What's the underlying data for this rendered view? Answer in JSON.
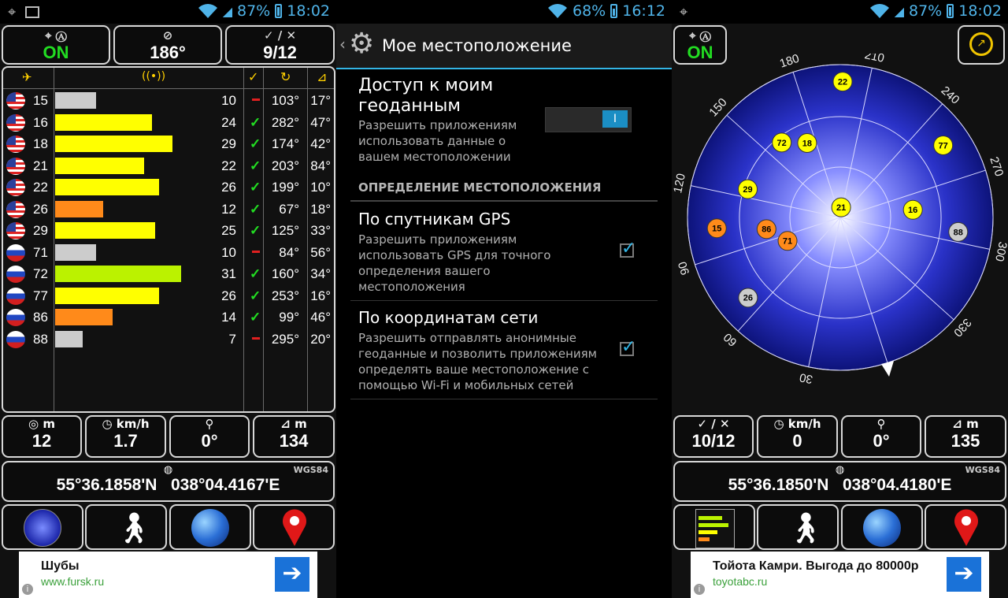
{
  "colors": {
    "accent": "#33b5e5",
    "status_blue": "#4fb3e8",
    "green": "#22dd22",
    "yellow": "#ffff00",
    "lime": "#bbf200",
    "orange": "#ff8a1a",
    "gray": "#cccccc"
  },
  "left": {
    "status": {
      "battery": "87%",
      "time": "18:02"
    },
    "tiles": {
      "gps_state": "ON",
      "heading": "186°",
      "sats": "9/12"
    },
    "satellites": [
      {
        "flag": "us",
        "id": "15",
        "snr": "10",
        "used": false,
        "az": "103°",
        "el": "17°",
        "color": "#cccccc",
        "frac": 0.22
      },
      {
        "flag": "us",
        "id": "16",
        "snr": "24",
        "used": true,
        "az": "282°",
        "el": "47°",
        "color": "#ffff00",
        "frac": 0.52
      },
      {
        "flag": "us",
        "id": "18",
        "snr": "29",
        "used": true,
        "az": "174°",
        "el": "42°",
        "color": "#ffff00",
        "frac": 0.63
      },
      {
        "flag": "us",
        "id": "21",
        "snr": "22",
        "used": true,
        "az": "203°",
        "el": "84°",
        "color": "#ffff00",
        "frac": 0.48
      },
      {
        "flag": "us",
        "id": "22",
        "snr": "26",
        "used": true,
        "az": "199°",
        "el": "10°",
        "color": "#ffff00",
        "frac": 0.56
      },
      {
        "flag": "us",
        "id": "26",
        "snr": "12",
        "used": true,
        "az": "67°",
        "el": "18°",
        "color": "#ff8a1a",
        "frac": 0.26
      },
      {
        "flag": "us",
        "id": "29",
        "snr": "25",
        "used": true,
        "az": "125°",
        "el": "33°",
        "color": "#ffff00",
        "frac": 0.54
      },
      {
        "flag": "ru",
        "id": "71",
        "snr": "10",
        "used": false,
        "az": "84°",
        "el": "56°",
        "color": "#cccccc",
        "frac": 0.22
      },
      {
        "flag": "ru",
        "id": "72",
        "snr": "31",
        "used": true,
        "az": "160°",
        "el": "34°",
        "color": "#bbf200",
        "frac": 0.68
      },
      {
        "flag": "ru",
        "id": "77",
        "snr": "26",
        "used": true,
        "az": "253°",
        "el": "16°",
        "color": "#ffff00",
        "frac": 0.56
      },
      {
        "flag": "ru",
        "id": "86",
        "snr": "14",
        "used": true,
        "az": "99°",
        "el": "46°",
        "color": "#ff8a1a",
        "frac": 0.31
      },
      {
        "flag": "ru",
        "id": "88",
        "snr": "7",
        "used": false,
        "az": "295°",
        "el": "20°",
        "color": "#cccccc",
        "frac": 0.15
      }
    ],
    "stats": {
      "acc_unit": "m",
      "acc": "12",
      "speed_unit": "km/h",
      "speed": "1.7",
      "bearing": "0°",
      "alt_unit": "m",
      "alt": "134"
    },
    "coords": {
      "datum": "WGS84",
      "lat": "55°36.1858'N",
      "lon": "038°04.4167'E"
    },
    "ad": {
      "title": "Шубы",
      "url": "www.fursk.ru"
    }
  },
  "middle": {
    "status": {
      "battery": "68%",
      "time": "16:12"
    },
    "title": "Мое местоположение",
    "access_title": "Доступ к моим геоданным",
    "access_title_line1": "Доступ к моим",
    "access_title_line2": "геоданным",
    "access_sub": "Разрешить приложениям использовать данные о вашем местоположении",
    "access_sub_lines": [
      "Разрешить приложениям",
      "использовать данные о",
      "вашем местоположении"
    ],
    "toggle_label": "I",
    "section": "ОПРЕДЕЛЕНИЕ МЕСТОПОЛОЖЕНИЯ",
    "gps_title": "По спутникам GPS",
    "gps_sub_lines": [
      "Разрешить приложениям",
      "использовать GPS для точного",
      "определения вашего",
      "местоположения"
    ],
    "net_title": "По координатам сети",
    "net_sub_lines": [
      "Разрешить отправлять анонимные",
      "геоданные и позволить приложениям",
      "определять ваше местоположение с",
      "помощью Wi-Fi и мобильных сетей"
    ]
  },
  "right": {
    "status": {
      "battery": "87%",
      "time": "18:02"
    },
    "gps_state": "ON",
    "compass_labels": [
      "30",
      "60",
      "90",
      "120",
      "150",
      "180",
      "210",
      "240",
      "270",
      "300",
      "330"
    ],
    "sky_sats": [
      {
        "id": "22",
        "color": "#ffff00"
      },
      {
        "id": "72",
        "color": "#ffff00"
      },
      {
        "id": "18",
        "color": "#ffff00"
      },
      {
        "id": "77",
        "color": "#ffff00"
      },
      {
        "id": "29",
        "color": "#ffff00"
      },
      {
        "id": "21",
        "color": "#ffff00"
      },
      {
        "id": "16",
        "color": "#ffff00"
      },
      {
        "id": "15",
        "color": "#ff8a1a"
      },
      {
        "id": "86",
        "color": "#ff8a1a"
      },
      {
        "id": "71",
        "color": "#ff8a1a"
      },
      {
        "id": "88",
        "color": "#cccccc"
      },
      {
        "id": "26",
        "color": "#cccccc"
      }
    ],
    "stats": {
      "sats": "10/12",
      "speed_unit": "km/h",
      "speed": "0",
      "bearing": "0°",
      "alt_unit": "m",
      "alt": "135"
    },
    "coords": {
      "datum": "WGS84",
      "lat": "55°36.1850'N",
      "lon": "038°04.4180'E"
    },
    "ad": {
      "title": "Тойота Камри. Выгода до 80000р",
      "url": "toyotabc.ru"
    }
  }
}
